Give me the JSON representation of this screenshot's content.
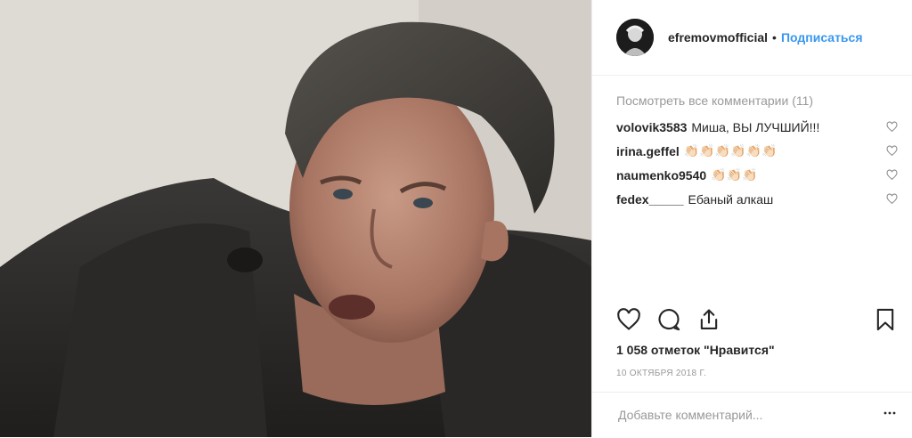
{
  "post": {
    "username": "efremovmofficial",
    "separator": "•",
    "follow_label": "Подписаться",
    "view_all_label": "Посмотреть все комментарии (11)",
    "comments": [
      {
        "user": "volovik3583",
        "text": "Миша, ВЫ ЛУЧШИЙ!!!"
      },
      {
        "user": "irina.geffel",
        "text": "👏🏻👏🏻👏🏻👏🏻👏🏻👏🏻"
      },
      {
        "user": "naumenko9540",
        "text": "👏🏻👏🏻👏🏻"
      },
      {
        "user": "fedex_____",
        "text": "Ебаный алкаш"
      }
    ],
    "likes_label": "1 058 отметок \"Нравится\"",
    "date": "10 ОКТЯБРЯ 2018 Г.",
    "add_comment_placeholder": "Добавьте комментарий..."
  },
  "icons": {
    "like": "heart-icon",
    "comment": "comment-icon",
    "share": "share-icon",
    "save": "bookmark-icon",
    "comment_like": "heart-icon",
    "more": "ellipsis-icon"
  },
  "colors": {
    "accent": "#3897f0",
    "text": "#262626",
    "muted": "#999999",
    "border": "#efefef"
  }
}
